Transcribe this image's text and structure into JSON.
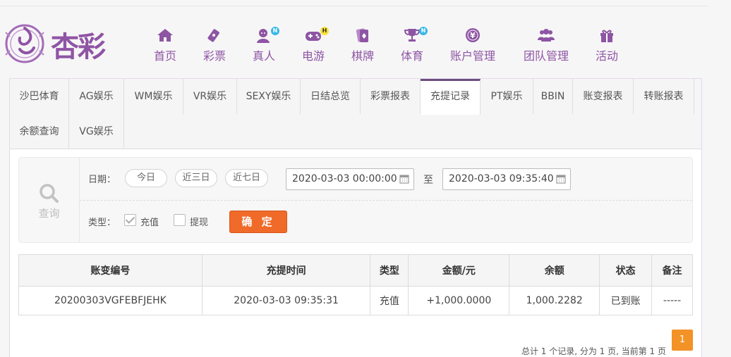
{
  "brand": {
    "logo_text": "杏彩"
  },
  "nav": [
    {
      "icon": "home-icon",
      "label": "首页"
    },
    {
      "icon": "lottery-ticket-icon",
      "label": "彩票"
    },
    {
      "icon": "live-dealer-icon",
      "label": "真人",
      "badge": "N"
    },
    {
      "icon": "gamepad-icon",
      "label": "电游",
      "badge": "H"
    },
    {
      "icon": "cards-icon",
      "label": "棋牌"
    },
    {
      "icon": "trophy-icon",
      "label": "体育",
      "badge": "N"
    },
    {
      "icon": "yuan-coin-icon",
      "label": "账户管理"
    },
    {
      "icon": "team-icon",
      "label": "团队管理"
    },
    {
      "icon": "gift-icon",
      "label": "活动"
    }
  ],
  "tabs": [
    "沙巴体育",
    "AG娱乐",
    "WM娱乐",
    "VR娱乐",
    "SEXY娱乐",
    "日结总览",
    "彩票报表",
    "充提记录",
    "PT娱乐",
    "BBIN",
    "账变报表",
    "转账报表",
    "余额查询",
    "VG娱乐"
  ],
  "active_tab": "充提记录",
  "query": {
    "label": "查询",
    "date_label": "日期：",
    "quick_dates": [
      "今日",
      "近三日",
      "近七日"
    ],
    "start": "2020-03-03 00:00:00",
    "to": "至",
    "end": "2020-03-03 09:35:40",
    "type_label": "类型：",
    "types": [
      {
        "label": "充值",
        "checked": true
      },
      {
        "label": "提现",
        "checked": false
      }
    ],
    "confirm": "确 定"
  },
  "table": {
    "headers": [
      "账变编号",
      "充提时间",
      "类型",
      "金额/元",
      "余额",
      "状态",
      "备注"
    ],
    "rows": [
      [
        "20200303VGFEBFJEHK",
        "2020-03-03 09:35:31",
        "充值",
        "+1,000.0000",
        "1,000.2282",
        "已到账",
        "-----"
      ]
    ]
  },
  "pagination": {
    "summary": "总计 1 个记录, 分为 1 页, 当前第 1 页",
    "current": "1"
  },
  "colors": {
    "brand_purple": "#8d55a3",
    "confirm_orange": "#f06a29",
    "page_orange": "#f39226",
    "amount_red": "#d9101b",
    "status_green": "#3d9a2e"
  }
}
